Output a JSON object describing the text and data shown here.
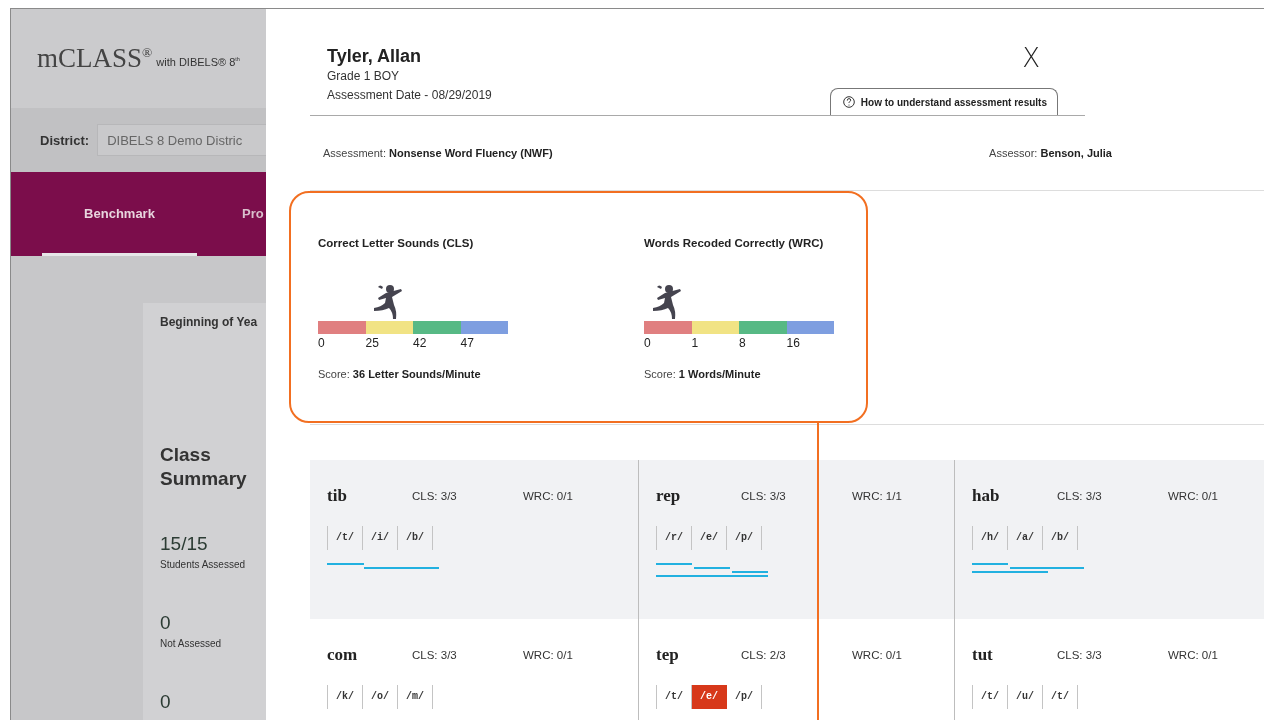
{
  "app": {
    "logo": "mCLASS$^{®}$",
    "logo_subtitle": "with DIBELS® 8$^{th}$",
    "district_label": "District:",
    "district_value": "DIBELS 8 Demo Distric",
    "nav_tabs": [
      {
        "label": "Benchmark",
        "selected": true
      },
      {
        "label": "Pro",
        "selected": false
      }
    ],
    "summary_card": {
      "period": "Beginning of Yea",
      "title": "Class Summary",
      "stats": [
        {
          "value": "15/15",
          "label": "Students Assessed"
        },
        {
          "value": "0",
          "label": "Not Assessed"
        },
        {
          "value": "0"
        }
      ]
    }
  },
  "student": {
    "name": "Tyler, Allan",
    "grade": "Grade 1 BOY",
    "date": "Assessment Date - 08/29/2019",
    "close": "X",
    "help_tab": "How to understand assessment results"
  },
  "assessment": {
    "label": "Assessment:",
    "value": "Nonsense Word Fluency (NWF)",
    "assessor_label": "Assessor:",
    "assessor": "Benson, Julia"
  },
  "measures": [
    {
      "title": "Correct Letter Sounds (CLS)",
      "thresholds": [
        {
          "label": "0",
          "marked": false
        },
        {
          "label": "25",
          "marked": true
        },
        {
          "label": "42",
          "marked": false
        },
        {
          "label": "47",
          "marked": false
        }
      ],
      "score_label": "Score:",
      "score": "36 Letter Sounds/Minute"
    },
    {
      "title": "Words Recoded Correctly (WRC)",
      "thresholds": [
        {
          "label": "0",
          "marked": true
        },
        {
          "label": "1",
          "marked": false
        },
        {
          "label": "8",
          "marked": false
        },
        {
          "label": "16",
          "marked": false
        }
      ],
      "score_label": "Score:",
      "score": "1 Words/Minute"
    }
  ],
  "words": [
    {
      "word": "tib",
      "cls": "CLS: 3/3",
      "wrc": "WRC: 0/1",
      "kind": "onset-rime",
      "sounds": [
        {
          "text": "/t/",
          "error": false
        },
        {
          "text": "/i/",
          "error": false
        },
        {
          "text": "/b/",
          "error": false
        }
      ]
    },
    {
      "word": "rep",
      "cls": "CLS: 3/3",
      "wrc": "WRC: 1/1",
      "kind": "sounds-and-word",
      "sounds": [
        {
          "text": "/r/",
          "error": false
        },
        {
          "text": "/e/",
          "error": false
        },
        {
          "text": "/p/",
          "error": false
        }
      ]
    },
    {
      "word": "hab",
      "cls": "CLS: 3/3",
      "wrc": "WRC: 0/1",
      "kind": "overlapping",
      "sounds": [
        {
          "text": "/h/",
          "error": false
        },
        {
          "text": "/a/",
          "error": false
        },
        {
          "text": "/b/",
          "error": false
        }
      ]
    },
    {
      "word": "com",
      "cls": "CLS: 3/3",
      "wrc": "WRC: 0/1",
      "sounds": [
        {
          "text": "/k/",
          "error": false
        },
        {
          "text": "/o/",
          "error": false
        },
        {
          "text": "/m/",
          "error": false
        }
      ]
    },
    {
      "word": "tep",
      "cls": "CLS: 2/3",
      "wrc": "WRC: 0/1",
      "sounds": [
        {
          "text": "/t/",
          "error": false
        },
        {
          "text": "/e/",
          "error": true
        },
        {
          "text": "/p/",
          "error": false
        }
      ]
    },
    {
      "word": "tut",
      "cls": "CLS: 3/3",
      "wrc": "WRC: 0/1",
      "sounds": [
        {
          "text": "/t/",
          "error": false
        },
        {
          "text": "/u/",
          "error": false
        },
        {
          "text": "/t/",
          "error": false
        }
      ]
    }
  ]
}
